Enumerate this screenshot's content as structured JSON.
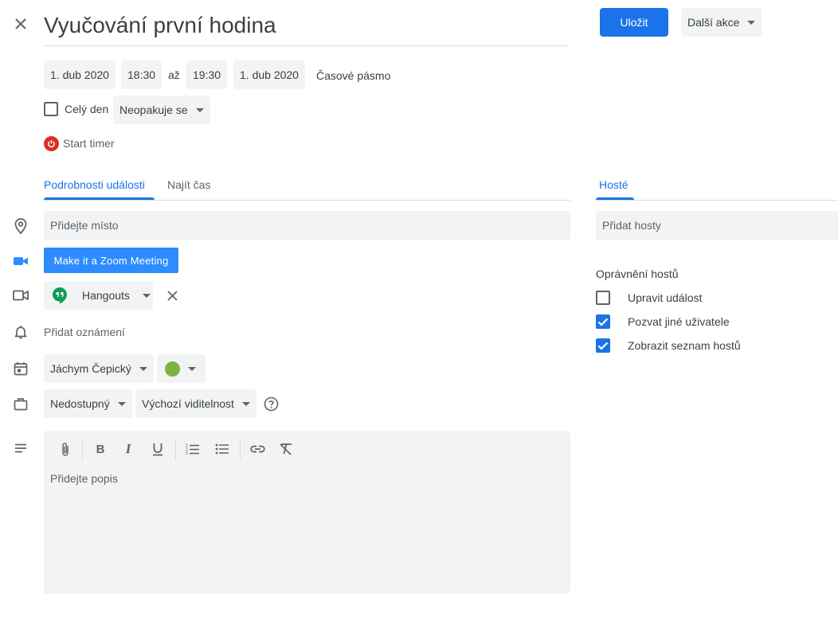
{
  "header": {
    "title": "Vyučování první hodina",
    "save_label": "Uložit",
    "more_actions_label": "Další akce"
  },
  "datetime": {
    "start_date": "1. dub 2020",
    "start_time": "18:30",
    "to_label": "až",
    "end_time": "19:30",
    "end_date": "1. dub 2020",
    "timezone_label": "Časové pásmo"
  },
  "options": {
    "all_day_label": "Celý den",
    "all_day_checked": false,
    "recurrence_value": "Neopakuje se"
  },
  "timer": {
    "label": "Start timer",
    "color": "#d93025"
  },
  "tabs": {
    "details": "Podrobnosti události",
    "find_time": "Najít čas",
    "guests": "Hosté"
  },
  "details": {
    "location_placeholder": "Přidejte místo",
    "zoom_button": "Make it a Zoom Meeting",
    "conference_value": "Hangouts",
    "notification_label": "Přidat oznámení",
    "calendar_owner": "Jáchym Čepický",
    "event_color": "#7cb342",
    "availability_value": "Nedostupný",
    "visibility_value": "Výchozí viditelnost",
    "description_placeholder": "Přidejte popis"
  },
  "guests": {
    "add_placeholder": "Přidat hosty",
    "permissions_title": "Oprávnění hostů",
    "permissions": [
      {
        "label": "Upravit událost",
        "checked": false
      },
      {
        "label": "Pozvat jiné uživatele",
        "checked": true
      },
      {
        "label": "Zobrazit seznam hostů",
        "checked": true
      }
    ]
  },
  "toolbar_icons": [
    "attach-icon",
    "bold-icon",
    "italic-icon",
    "underline-icon",
    "numbered-list-icon",
    "bulleted-list-icon",
    "link-icon",
    "clear-format-icon"
  ],
  "colors": {
    "accent": "#1a73e8",
    "chip_bg": "#f1f3f4",
    "zoom_blue": "#2d8cff",
    "hangouts_green": "#0f9d58"
  }
}
